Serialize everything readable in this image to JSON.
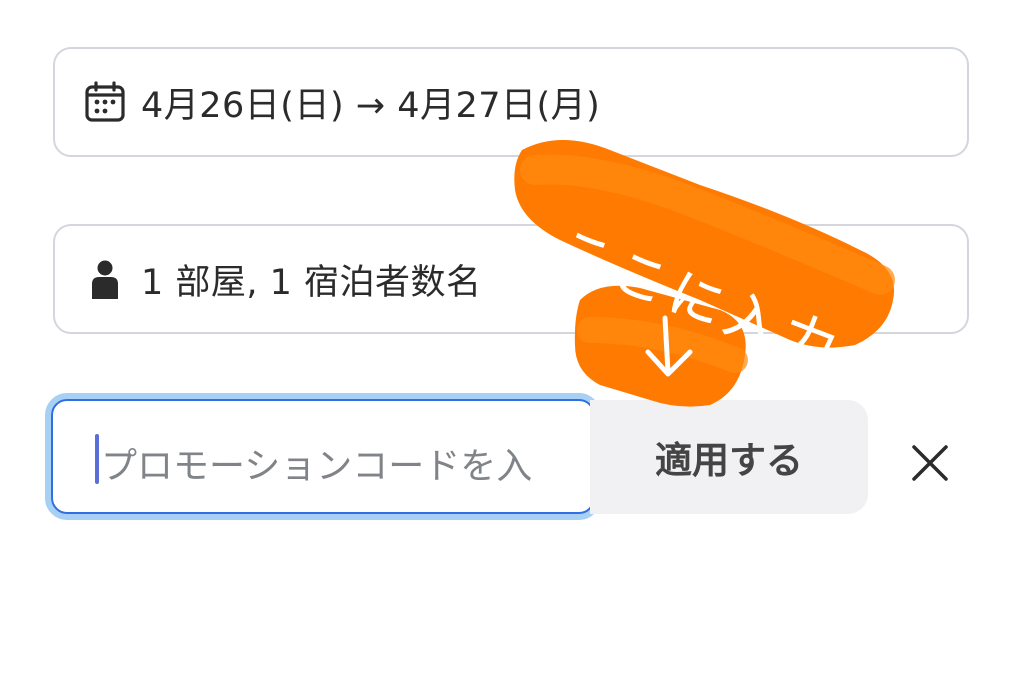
{
  "booking": {
    "dates_text": "4月26日(日) → 4月27日(月)",
    "dates_icon": "calendar-icon",
    "guests_text": "1 部屋, 1 宿泊者数名",
    "guests_icon": "person-icon"
  },
  "promo": {
    "placeholder": "プロモーションコードを入",
    "apply_label": "適用する",
    "close_icon": "close-icon"
  },
  "annotation": {
    "text": "ここに入力",
    "arrow_icon": "down-arrow-icon",
    "color": "#ff7a00"
  },
  "colors": {
    "border": "#d3d6dd",
    "focus_ring": "#a8d0f5",
    "focus_border": "#2f6fe0",
    "button_bg": "#f1f1f4"
  }
}
